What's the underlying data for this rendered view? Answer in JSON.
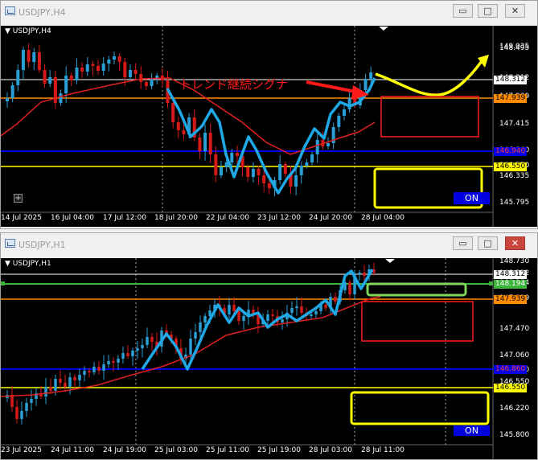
{
  "w1": {
    "title": "USDJPY,H4",
    "sym": "USDJPY,H4",
    "prices": [
      "149.035",
      "148.495",
      "148.312",
      "147.939",
      "147.415",
      "146.940",
      "146.550",
      "146.335",
      "145.795"
    ],
    "times": [
      "14 Jul 2025",
      "16 Jul 04:00",
      "17 Jul 12:00",
      "18 Jul 20:00",
      "22 Jul 04:00",
      "23 Jul 12:00",
      "24 Jul 20:00",
      "28 Jul 04:00"
    ],
    "signal": "トレンド継続シグナ",
    "on": "ON"
  },
  "w2": {
    "title": "USDJPY,H1",
    "sym": "USDJPY,H1",
    "prices": [
      "148.730",
      "148.312",
      "148.194",
      "147.939",
      "147.470",
      "147.060",
      "146.860",
      "146.550",
      "146.220",
      "145.800"
    ],
    "times": [
      "23 Jul 2025",
      "24 Jul 11:00",
      "24 Jul 19:00",
      "25 Jul 03:00",
      "25 Jul 11:00",
      "25 Jul 19:00",
      "28 Jul 03:00",
      "28 Jul 11:00"
    ],
    "on": "ON"
  },
  "buttons": {
    "min": "▭",
    "max": "□",
    "close": "✕"
  },
  "colors": {
    "bg": "#000000",
    "bull": "#2a9fd6",
    "bear": "#d61a1a",
    "ma": "#e02020",
    "wave": "#1ea8e6",
    "orange": "#ff8c00",
    "yellow": "#ffff00",
    "blue": "#0000e6",
    "green": "#3cb43c"
  }
}
